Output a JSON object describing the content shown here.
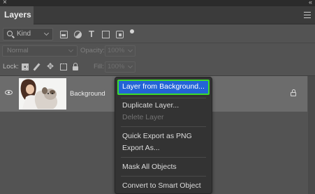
{
  "window": {
    "close_glyph": "×",
    "collapse_glyph": "«"
  },
  "panel": {
    "tab_label": "Layers",
    "menu_icon": "hamburger-icon"
  },
  "filter": {
    "kind_label": "Kind",
    "icons": [
      "pixel-layer-filter-icon",
      "adjustment-filter-icon",
      "type-filter-icon",
      "shape-filter-icon",
      "smart-object-filter-icon",
      "filter-toggle-icon"
    ],
    "type_glyph": "T"
  },
  "blend": {
    "mode_value": "Normal",
    "opacity_label": "Opacity:",
    "opacity_value": "100%"
  },
  "lock": {
    "label": "Lock:",
    "icons": [
      "lock-transparent-icon",
      "lock-paint-icon",
      "lock-position-icon",
      "lock-artboard-icon",
      "lock-all-icon"
    ],
    "move_glyph": "✥",
    "fill_label": "Fill:",
    "fill_value": "100%"
  },
  "layer": {
    "name": "Background",
    "visible": true,
    "locked": true
  },
  "context_menu": {
    "highlighted": "Layer from Background...",
    "group1": [
      "Duplicate Layer...",
      "Delete Layer"
    ],
    "group2": [
      "Quick Export as PNG",
      "Export As..."
    ],
    "group3": [
      "Mask All Objects"
    ],
    "group4": [
      "Convert to Smart Object"
    ]
  },
  "colors": {
    "panel_bg": "#535353",
    "selected_row": "#6c6c6c",
    "menu_bg": "#333333",
    "menu_highlight": "#2364d6",
    "annotation_outline": "#3cdc2c"
  }
}
